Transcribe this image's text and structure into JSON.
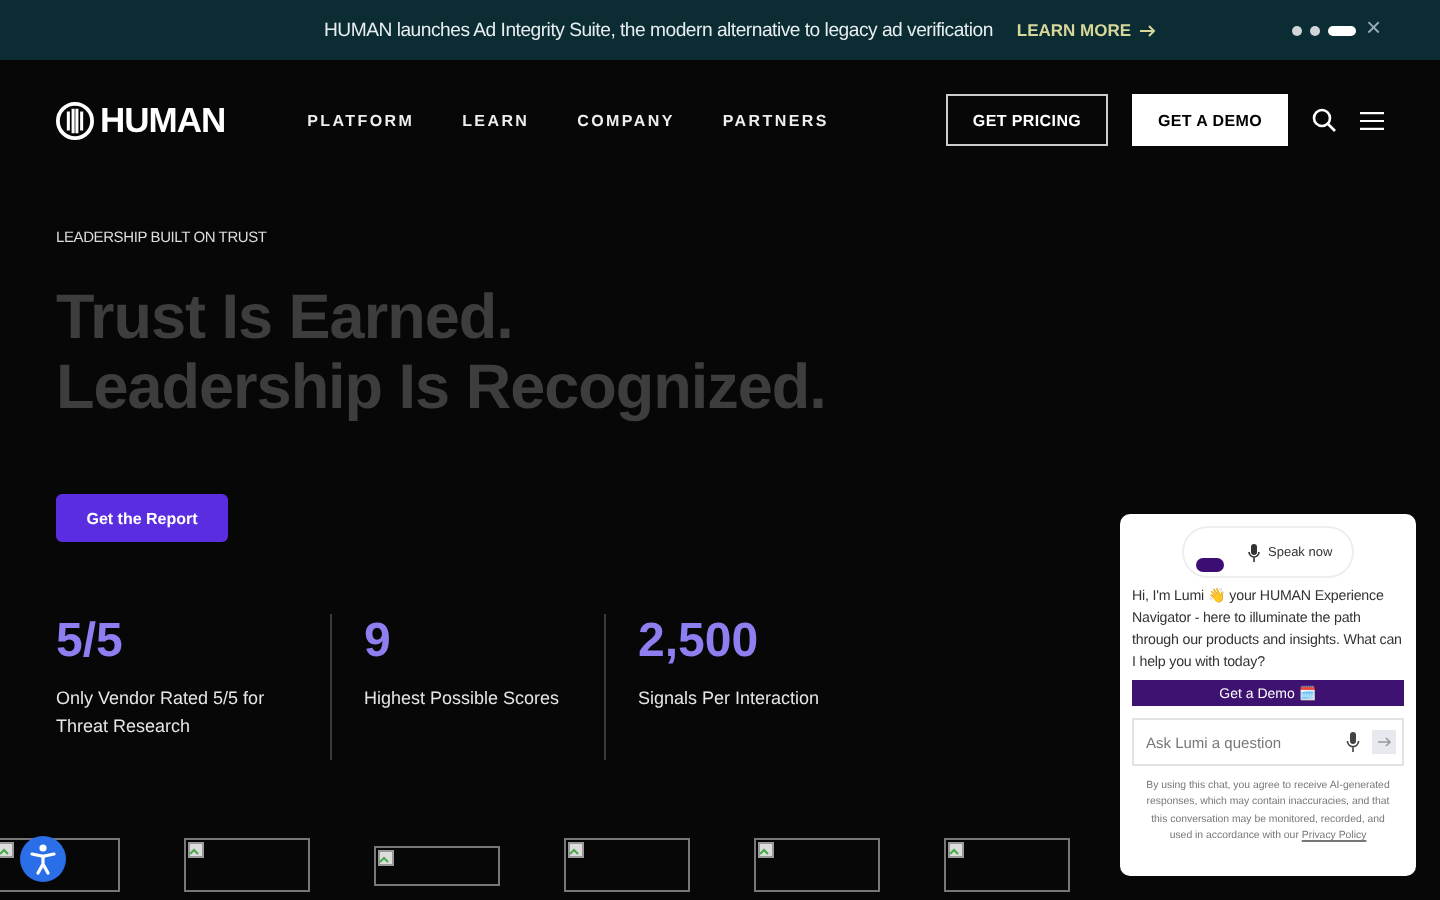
{
  "announcement": {
    "text": "HUMAN launches Ad Integrity Suite, the modern alternative to legacy ad verification",
    "link": "LEARN MORE",
    "slides": [
      {
        "selected": false
      },
      {
        "selected": false
      },
      {
        "selected": true
      }
    ],
    "close": "×"
  },
  "nav": {
    "brand": "HUMAN",
    "links": [
      "PLATFORM",
      "LEARN",
      "COMPANY",
      "PARTNERS"
    ],
    "buttons": [
      {
        "label": "GET PRICING",
        "kind": "outline"
      },
      {
        "label": "GET A DEMO",
        "kind": "solid"
      }
    ]
  },
  "hero": {
    "eyebrow": "LEADERSHIP BUILT ON TRUST",
    "headline": [
      "Trust Is Earned.",
      "Leadership Is Recognized."
    ],
    "cta": "Get the Report"
  },
  "stats": [
    {
      "value": "5/5",
      "label": "Only Vendor Rated 5/5 for Threat Research"
    },
    {
      "value": "9",
      "label": "Highest Possible Scores"
    },
    {
      "value": "2,500",
      "label": "Signals Per Interaction"
    }
  ],
  "logos": [
    {
      "kind": "broken-image"
    },
    {
      "kind": "broken-image"
    },
    {
      "kind": "broken-image-short"
    },
    {
      "kind": "broken-image"
    },
    {
      "kind": "broken-image"
    },
    {
      "kind": "broken-image"
    }
  ],
  "chat": {
    "speak": "Speak now",
    "message": "Hi, I'm Lumi 👋 your HUMAN Experience Navigator - here to illuminate the path through our products and insights. What can I help you with today?",
    "demo": "Get a Demo 🗓️",
    "placeholder": "Ask Lumi a question",
    "disclaimer": "By using this chat, you agree to receive AI-generated responses, which may contain inaccuracies, and that this conversation may be monitored, recorded, and used in accordance with our",
    "policy": "Privacy Policy"
  }
}
